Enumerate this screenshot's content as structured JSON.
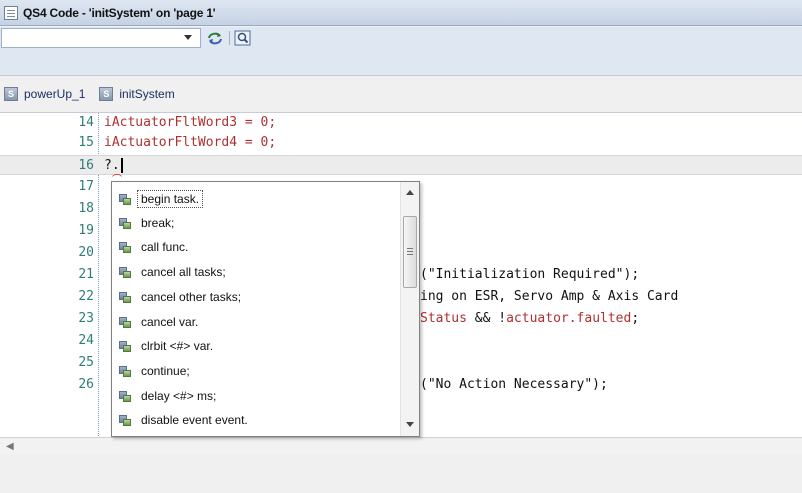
{
  "window": {
    "title": "QS4 Code - 'initSystem' on 'page 1'"
  },
  "toolbar": {
    "combo_value": "",
    "icons": [
      "refresh-icon",
      "find-icon"
    ]
  },
  "tabs": [
    {
      "label": "powerUp_1",
      "icon": "subroutine-icon"
    },
    {
      "label": "initSystem",
      "icon": "subroutine-icon"
    }
  ],
  "editor": {
    "lines": [
      {
        "num": "14",
        "code": "iActuatorFltWord3 = 0;"
      },
      {
        "num": "15",
        "code": "iActuatorFltWord4 = 0;"
      },
      {
        "num": "16",
        "code": "?."
      },
      {
        "num": "17",
        "code": ""
      },
      {
        "num": "18",
        "code": ""
      },
      {
        "num": "19",
        "code": ""
      },
      {
        "num": "20",
        "code": ""
      },
      {
        "num": "21",
        "code": "(\"Initialization Required\");"
      },
      {
        "num": "22",
        "code": "ing on ESR, Servo Amp & Axis Card"
      },
      {
        "num": "23",
        "code_a": "Status",
        "code_b": " && !",
        "code_c": "actuator.faulted",
        "code_d": ";"
      },
      {
        "num": "24",
        "code": ""
      },
      {
        "num": "25",
        "code": ""
      },
      {
        "num": "26",
        "code": "(\"No Action Necessary\");"
      }
    ]
  },
  "autocomplete": {
    "items": [
      "begin task.",
      "break;",
      "call func.",
      "cancel all tasks;",
      "cancel other tasks;",
      "cancel var.",
      "clrbit <#> var.",
      "continue;",
      "delay <#> ms;",
      "disable event event."
    ],
    "selected_index": 0
  },
  "colors": {
    "line_number": "#2e7d79",
    "variable": "#b03030",
    "tab_text": "#1d2f63"
  }
}
